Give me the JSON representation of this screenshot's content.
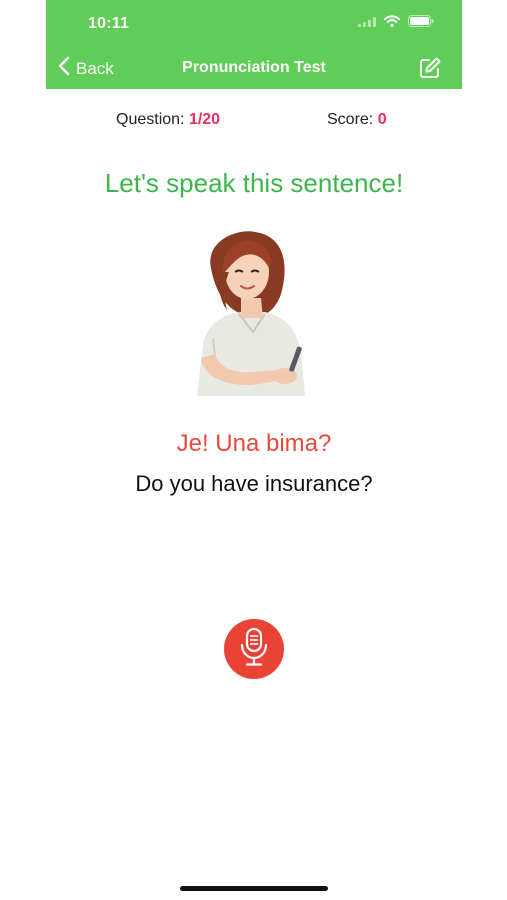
{
  "status_bar": {
    "time": "10:11",
    "icons": [
      "signal-icon",
      "wifi-icon",
      "battery-icon"
    ]
  },
  "nav": {
    "back_label": "Back",
    "title": "Pronunciation Test",
    "edit_icon": "edit-icon"
  },
  "stats": {
    "question_label": "Question:",
    "question_value": "1/20",
    "score_label": "Score:",
    "score_value": "0"
  },
  "prompt": "Let's speak this sentence!",
  "phrase": "Je! Una bima?",
  "translation": "Do you have insurance?",
  "mic_icon": "microphone-icon",
  "colors": {
    "header": "#5fcd57",
    "prompt": "#3cb64c",
    "accent": "#e8315a",
    "phrase": "#e84a3a",
    "mic": "#ea4335"
  }
}
